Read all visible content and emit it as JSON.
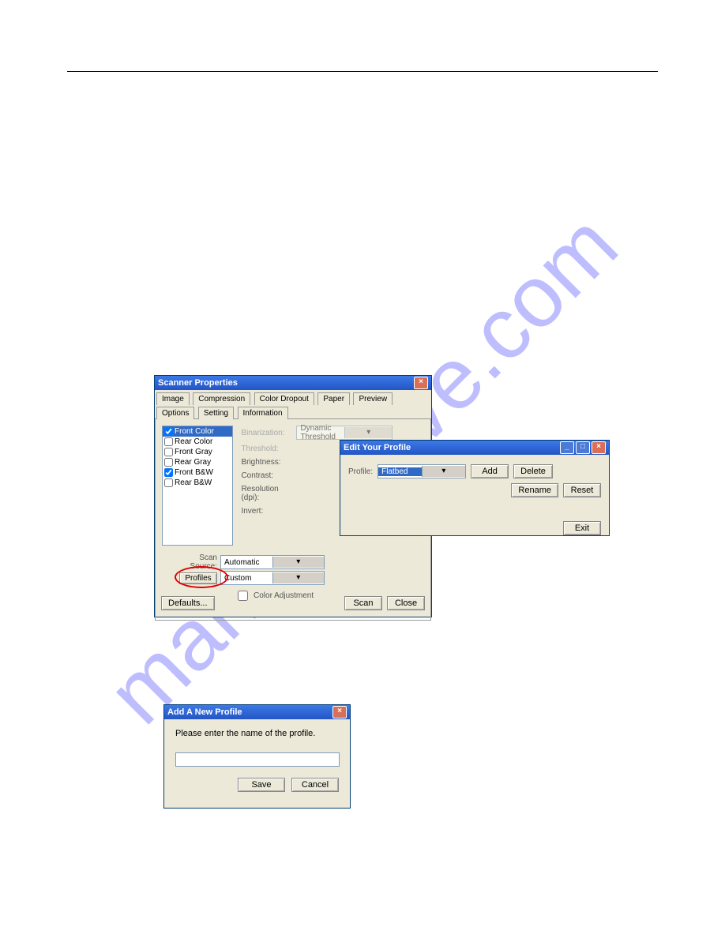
{
  "watermark": "manualshive.com",
  "scanner": {
    "title": "Scanner Properties",
    "tabs": [
      "Image",
      "Compression",
      "Color Dropout",
      "Paper",
      "Preview",
      "Options",
      "Setting",
      "Information"
    ],
    "image_list": [
      "Front Color",
      "Rear Color",
      "Front Gray",
      "Rear Gray",
      "Front B&W",
      "Rear B&W"
    ],
    "fields": {
      "binarization": "Binarization:",
      "threshold": "Threshold:",
      "brightness": "Brightness:",
      "contrast": "Contrast:",
      "resolution": "Resolution (dpi):",
      "invert": "Invert:",
      "scan_source": "Scan Source:",
      "color_adjustment": "Color Adjustment"
    },
    "values": {
      "binarization": "Dynamic Threshold",
      "scan_source": "Automatic",
      "profiles": "Custom"
    },
    "buttons": {
      "profiles": "Profiles",
      "defaults": "Defaults...",
      "scan": "Scan",
      "close": "Close"
    }
  },
  "edit_profile": {
    "title": "Edit Your Profile",
    "fields": {
      "profile": "Profile:"
    },
    "values": {
      "profile": "Flatbed"
    },
    "buttons": {
      "add": "Add",
      "delete": "Delete",
      "rename": "Rename",
      "reset": "Reset",
      "exit": "Exit"
    }
  },
  "add_profile": {
    "title": "Add A New Profile",
    "prompt": "Please enter the name of the profile.",
    "value": "",
    "buttons": {
      "save": "Save",
      "cancel": "Cancel"
    }
  }
}
